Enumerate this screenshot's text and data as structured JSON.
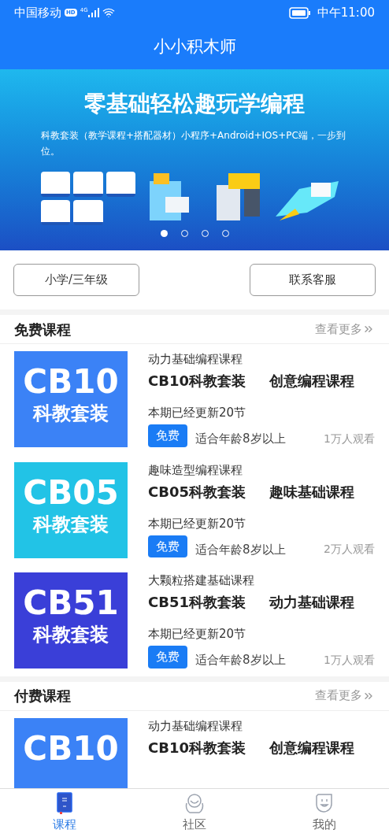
{
  "status_bar": {
    "carrier": "中国移动",
    "hd_label": "HD",
    "network": "4G",
    "time": "中午11:00"
  },
  "header": {
    "title": "小小积木师"
  },
  "banner": {
    "headline": "零基础轻松趣玩学编程",
    "text": "科教套装（教学课程+搭配器材）小程序+Android+IOS+PC端，一步到位。",
    "dots": [
      {
        "selected": true
      },
      {
        "selected": false
      },
      {
        "selected": false
      },
      {
        "selected": false
      }
    ]
  },
  "actions": [
    {
      "label": "小学/三年级"
    },
    {
      "label": "联系客服"
    }
  ],
  "sections": [
    {
      "title": "免费课程",
      "more": "查看更多",
      "courses": [
        {
          "color": "#3b82f6",
          "cover_title": "CB10",
          "cover_subtitle": "科教套装",
          "category": "动力基础编程课程",
          "title": "CB10科教套装",
          "subtitle": "创意编程课程",
          "updates": "本期已经更新20节",
          "badge": "免费",
          "age": "适合年龄8岁以上",
          "views": "1万人观看"
        },
        {
          "color": "#22c3e6",
          "cover_title": "CB05",
          "cover_subtitle": "科教套装",
          "category": "趣味造型编程课程",
          "title": "CB05科教套装",
          "subtitle": "趣味基础课程",
          "updates": "本期已经更新20节",
          "badge": "免费",
          "age": "适合年龄8岁以上",
          "views": "2万人观看"
        },
        {
          "color": "#3a3fd8",
          "cover_title": "CB51",
          "cover_subtitle": "科教套装",
          "category": "大颗粒搭建基础课程",
          "title": "CB51科教套装",
          "subtitle": "动力基础课程",
          "updates": "本期已经更新20节",
          "badge": "免费",
          "age": "适合年龄8岁以上",
          "views": "1万人观看"
        }
      ]
    },
    {
      "title": "付费课程",
      "more": "查看更多",
      "courses": [
        {
          "color": "#3b82f6",
          "cover_title": "CB10",
          "category": "动力基础编程课程",
          "title": "CB10科教套装",
          "subtitle": "创意编程课程"
        }
      ]
    }
  ],
  "tabs": [
    {
      "label": "课程",
      "selected": true
    },
    {
      "label": "社区",
      "selected": false
    },
    {
      "label": "我的",
      "selected": false
    }
  ]
}
